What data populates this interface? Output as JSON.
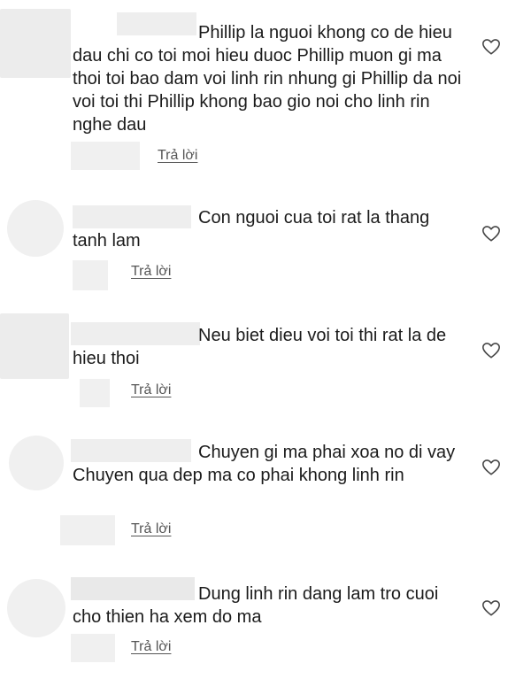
{
  "comments": [
    {
      "text": "Phillip la nguoi khong co de hieu dau chi co toi moi hieu duoc Phillip muon gi ma thoi toi bao dam voi linh rin nhung gi Phillip da noi voi toi thi Phillip khong bao gio noi cho linh rin nghe dau",
      "reply_label": "Trả lời"
    },
    {
      "text": "Con nguoi cua toi rat la thang tanh lam",
      "reply_label": "Trả lời"
    },
    {
      "text": "Neu biet dieu voi toi thi rat la de hieu thoi",
      "reply_label": "Trả lời"
    },
    {
      "text": "Chuyen gi ma phai xoa no di vay Chuyen qua dep ma co phai khong linh rin",
      "reply_label": "Trả lời"
    },
    {
      "text": "Dung linh rin dang lam tro cuoi cho thien ha xem do ma",
      "reply_label": "Trả lời"
    }
  ],
  "icons": {
    "like": "heart-outline-icon"
  },
  "colors": {
    "background": "#ffffff",
    "text": "#1b1b1b",
    "reply": "#555555",
    "redaction": "#eeeeee"
  }
}
